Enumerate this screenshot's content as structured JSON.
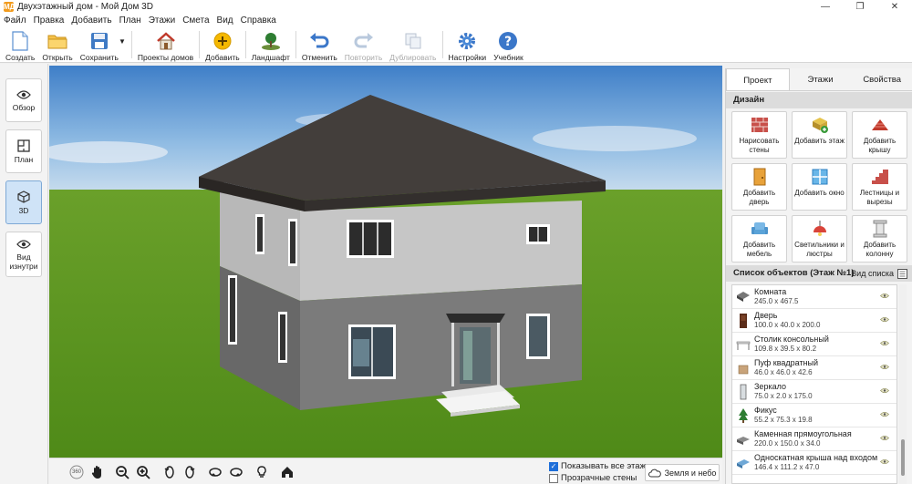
{
  "window": {
    "title": "Двухэтажный дом - Мой Дом 3D",
    "app_icon": "МД",
    "controls": [
      "—",
      "❐",
      "✕"
    ]
  },
  "menu": [
    "Файл",
    "Правка",
    "Добавить",
    "План",
    "Этажи",
    "Смета",
    "Вид",
    "Справка"
  ],
  "toolbar": {
    "create": "Создать",
    "open": "Открыть",
    "save": "Сохранить",
    "projects": "Проекты домов",
    "add": "Добавить",
    "landscape": "Ландшафт",
    "undo": "Отменить",
    "redo": "Повторить",
    "duplicate": "Дублировать",
    "settings": "Настройки",
    "tutorial": "Учебник"
  },
  "left_nav": {
    "overview": "Обзор",
    "plan": "План",
    "view3d": "3D",
    "inside": "Вид изнутри"
  },
  "bottom": {
    "show_all_floors": "Показывать все этажи",
    "show_all_floors_checked": true,
    "transparent_walls": "Прозрачные стены",
    "transparent_walls_checked": false,
    "ground_sky": "Земля и небо",
    "rotate360": "360"
  },
  "right_panel": {
    "tabs": [
      "Проект",
      "Этажи",
      "Свойства"
    ],
    "active_tab": 0,
    "design_header": "Дизайн",
    "design_items": [
      {
        "label": "Нарисовать стены",
        "icon": "brick-wall-icon"
      },
      {
        "label": "Добавить этаж",
        "icon": "add-floor-icon"
      },
      {
        "label": "Добавить крышу",
        "icon": "roof-icon"
      },
      {
        "label": "Добавить дверь",
        "icon": "door-icon"
      },
      {
        "label": "Добавить окно",
        "icon": "window-icon"
      },
      {
        "label": "Лестницы и вырезы",
        "icon": "stairs-icon"
      },
      {
        "label": "Добавить мебель",
        "icon": "armchair-icon"
      },
      {
        "label": "Светильники и люстры",
        "icon": "chandelier-icon"
      },
      {
        "label": "Добавить колонну",
        "icon": "column-icon"
      }
    ],
    "objects_header": "Список объектов (Этаж №1)",
    "list_view": "Вид списка",
    "objects": [
      {
        "name": "Комната",
        "dims": "245.0 x 467.5",
        "icon": "room-icon"
      },
      {
        "name": "Дверь",
        "dims": "100.0 x 40.0 x 200.0",
        "icon": "door-icon"
      },
      {
        "name": "Столик консольный",
        "dims": "109.8 x 39.5 x 80.2",
        "icon": "table-icon"
      },
      {
        "name": "Пуф квадратный",
        "dims": "46.0 x 46.0 x 42.6",
        "icon": "pouf-icon"
      },
      {
        "name": "Зеркало",
        "dims": "75.0 x 2.0 x 175.0",
        "icon": "mirror-icon"
      },
      {
        "name": "Фикус",
        "dims": "55.2 x 75.3 x 19.8",
        "icon": "plant-icon"
      },
      {
        "name": "Каменная прямоугольная",
        "dims": "220.0 x 150.0 x 34.0",
        "icon": "stone-icon"
      },
      {
        "name": "Односкатная крыша над входом",
        "dims": "146.4 x 111.2 x 47.0",
        "icon": "canopy-icon"
      }
    ]
  }
}
